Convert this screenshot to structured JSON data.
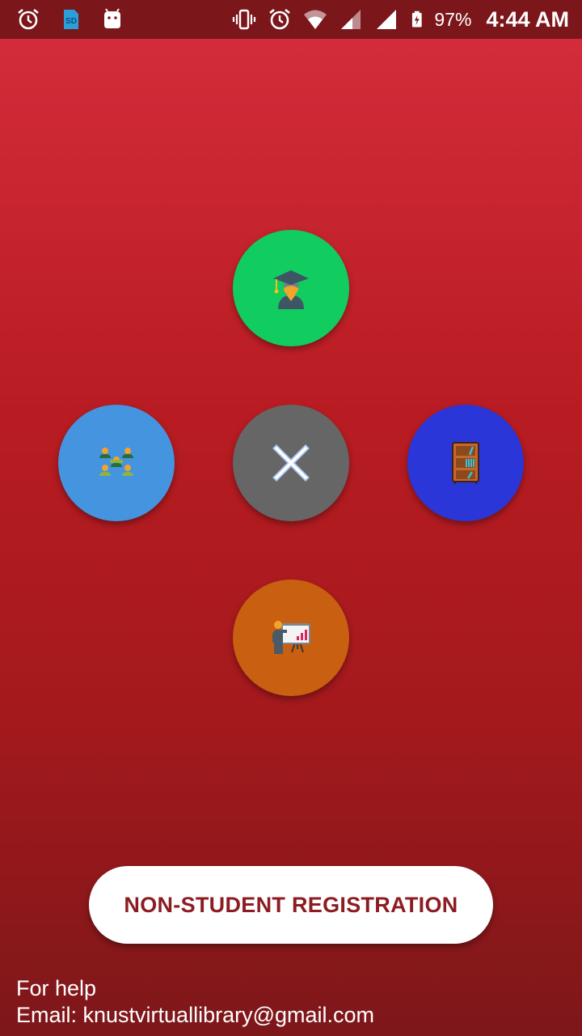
{
  "status_bar": {
    "left_icons": [
      "alarm-icon",
      "sd-card-icon",
      "android-icon"
    ],
    "right_icons": [
      "vibrate-icon",
      "alarm-icon",
      "wifi-icon",
      "signal-icon",
      "signal-icon",
      "battery-charging-icon"
    ],
    "battery_percent": "97%",
    "time": "4:44 AM"
  },
  "fab_menu": {
    "student": {
      "icon": "graduate-icon",
      "color": "#11cc5e"
    },
    "group": {
      "icon": "people-group-icon",
      "color": "#4494e0"
    },
    "close": {
      "icon": "close-icon",
      "color": "#666666"
    },
    "library": {
      "icon": "bookshelf-icon",
      "color": "#2b36d8"
    },
    "lecturer": {
      "icon": "presenter-icon",
      "color": "#c95f10"
    }
  },
  "registration_button": {
    "label": "NON-STUDENT REGISTRATION"
  },
  "help": {
    "line1": "For help",
    "line2": "Email: knustvirtuallibrary@gmail.com"
  },
  "colors": {
    "background_top": "#d62d3c",
    "background_bottom": "#7d171a",
    "status_bar": "#7b161b",
    "button_text": "#8c1c22"
  }
}
